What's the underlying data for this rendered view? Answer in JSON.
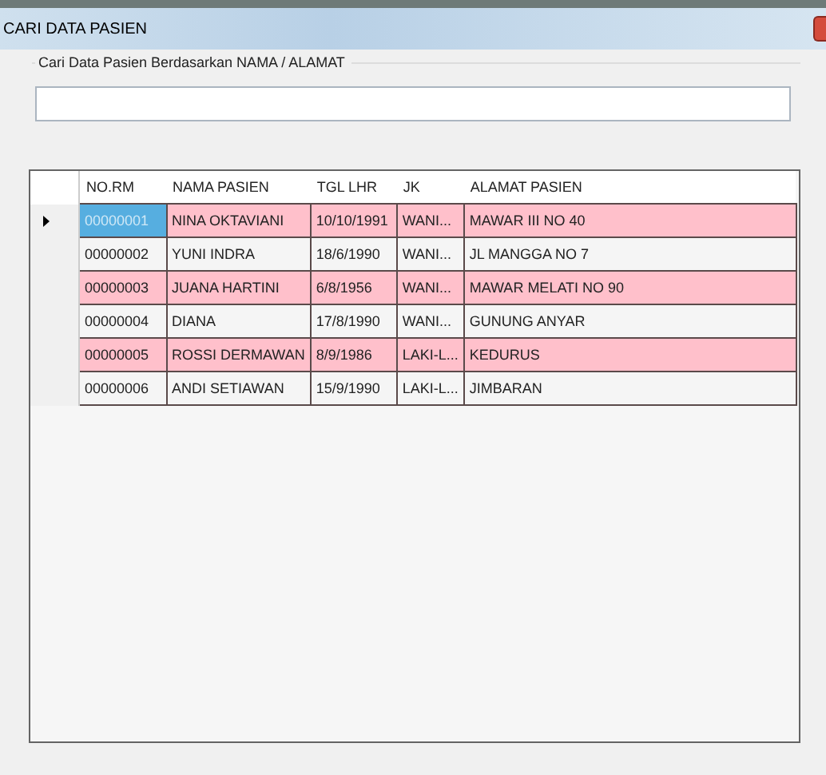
{
  "window": {
    "title": "CARI DATA PASIEN"
  },
  "search": {
    "label": "Cari Data Pasien Berdasarkan NAMA / ALAMAT"
  },
  "table": {
    "columns": [
      "NO.RM",
      "NAMA PASIEN",
      "TGL LHR",
      "JK",
      "ALAMAT PASIEN"
    ],
    "rows": [
      {
        "cells": [
          "00000001",
          "NINA OKTAVIANI",
          "10/10/1991",
          "WANI...",
          "MAWAR III NO 40"
        ],
        "color": "#ffc0cb",
        "selected": true
      },
      {
        "cells": [
          "00000002",
          "YUNI INDRA",
          "18/6/1990",
          "WANI...",
          "JL MANGGA NO 7"
        ],
        "color": "#f5f5f5",
        "selected": false
      },
      {
        "cells": [
          "00000003",
          "JUANA HARTINI",
          "6/8/1956",
          "WANI...",
          "MAWAR MELATI NO 90"
        ],
        "color": "#ffc0cb",
        "selected": false
      },
      {
        "cells": [
          "00000004",
          "DIANA",
          "17/8/1990",
          "WANI...",
          "GUNUNG ANYAR"
        ],
        "color": "#f5f5f5",
        "selected": false
      },
      {
        "cells": [
          "00000005",
          "ROSSI DERMAWAN",
          "8/9/1986",
          "LAKI-L...",
          "KEDURUS"
        ],
        "color": "#ffc0cb",
        "selected": false
      },
      {
        "cells": [
          "00000006",
          "ANDI SETIAWAN",
          "15/9/1990",
          "LAKI-L...",
          "JIMBARAN"
        ],
        "color": "#f5f5f5",
        "selected": false
      }
    ]
  }
}
